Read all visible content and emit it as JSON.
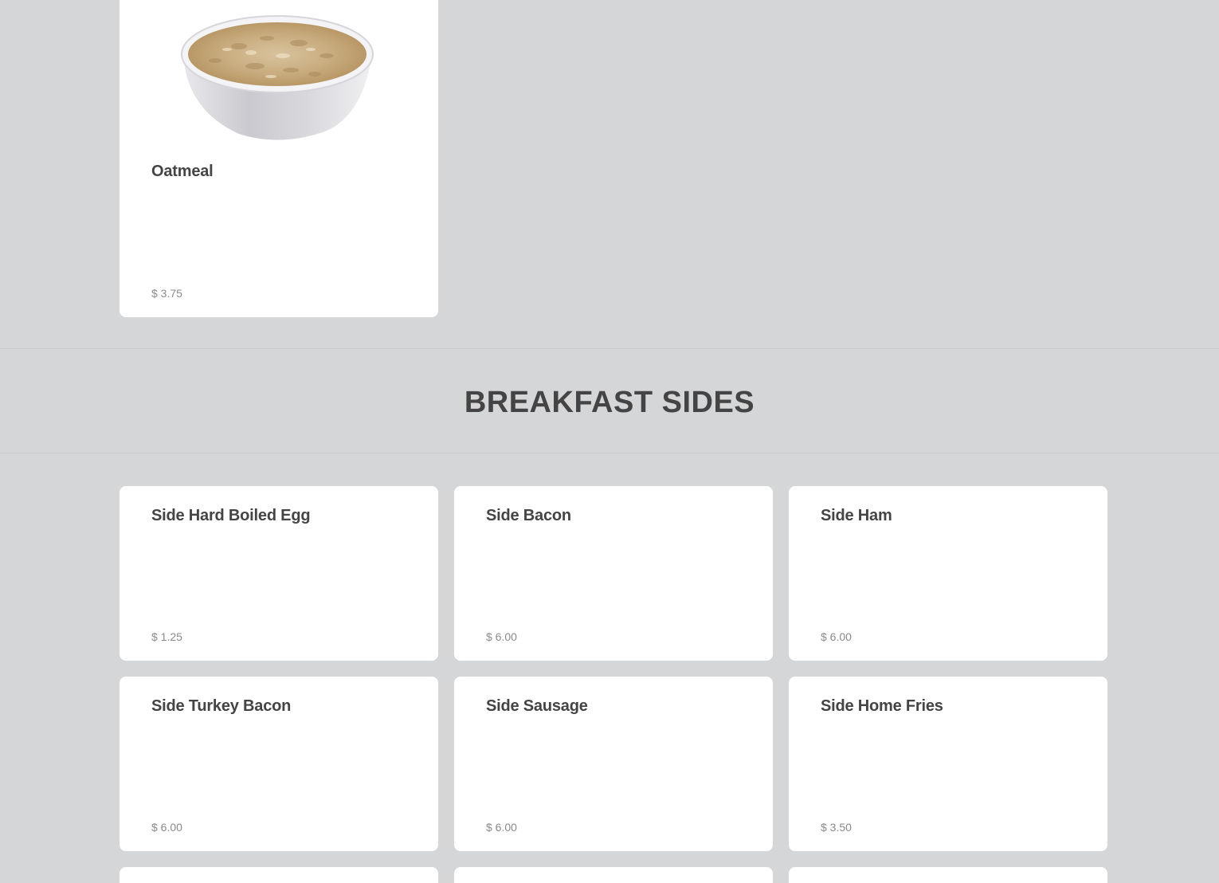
{
  "previous_section": {
    "items": [
      {
        "name": "Oatmeal",
        "price": "$ 3.75",
        "image": "oatmeal-bowl-photo"
      }
    ]
  },
  "breakfast_sides": {
    "title": "BREAKFAST SIDES",
    "items": [
      {
        "name": "Side Hard Boiled Egg",
        "price": "$ 1.25"
      },
      {
        "name": "Side Bacon",
        "price": "$ 6.00"
      },
      {
        "name": "Side Ham",
        "price": "$ 6.00"
      },
      {
        "name": "Side Turkey Bacon",
        "price": "$ 6.00"
      },
      {
        "name": "Side Sausage",
        "price": "$ 6.00"
      },
      {
        "name": "Side Home Fries",
        "price": "$ 3.50"
      }
    ]
  },
  "colors": {
    "page_background": "#d5d6d8",
    "card_background": "#ffffff",
    "heading_text": "#444444",
    "price_text": "#8a8a8a"
  }
}
